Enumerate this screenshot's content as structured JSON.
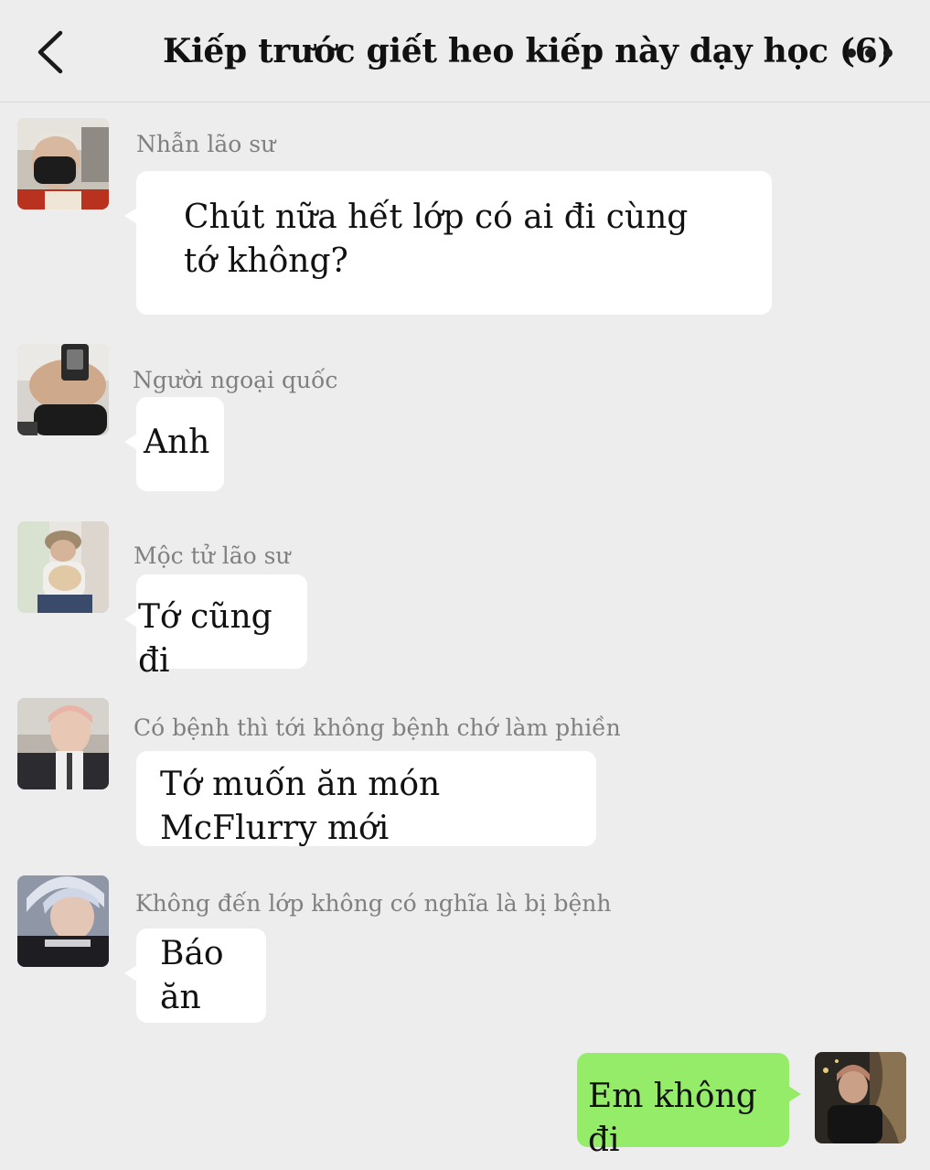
{
  "header": {
    "title": "Kiếp trước giết heo kiếp này dạy học (6)",
    "back_icon": "chevron-left-icon",
    "more_icon": "more-dots-icon"
  },
  "messages": [
    {
      "sender": "Nhẫn lão sư",
      "text": "Chút nữa hết lớp có ai đi cùng tớ không?",
      "side": "left"
    },
    {
      "sender": "Người ngoại quốc",
      "text": "Anh",
      "side": "left"
    },
    {
      "sender": "Mộc tử lão sư",
      "text": "Tớ cũng đi",
      "side": "left"
    },
    {
      "sender": "Có bệnh thì tới không bệnh chớ làm phiền",
      "text": "Tớ muốn ăn món McFlurry mới",
      "side": "left"
    },
    {
      "sender": "Không đến lớp không có nghĩa là bị bệnh",
      "text": "Báo ăn",
      "side": "left"
    },
    {
      "sender": "",
      "text": "Em không đi",
      "side": "right"
    }
  ],
  "colors": {
    "background": "#ededed",
    "bubble_incoming": "#ffffff",
    "bubble_outgoing": "#95ec69",
    "sender_name": "#808080"
  }
}
